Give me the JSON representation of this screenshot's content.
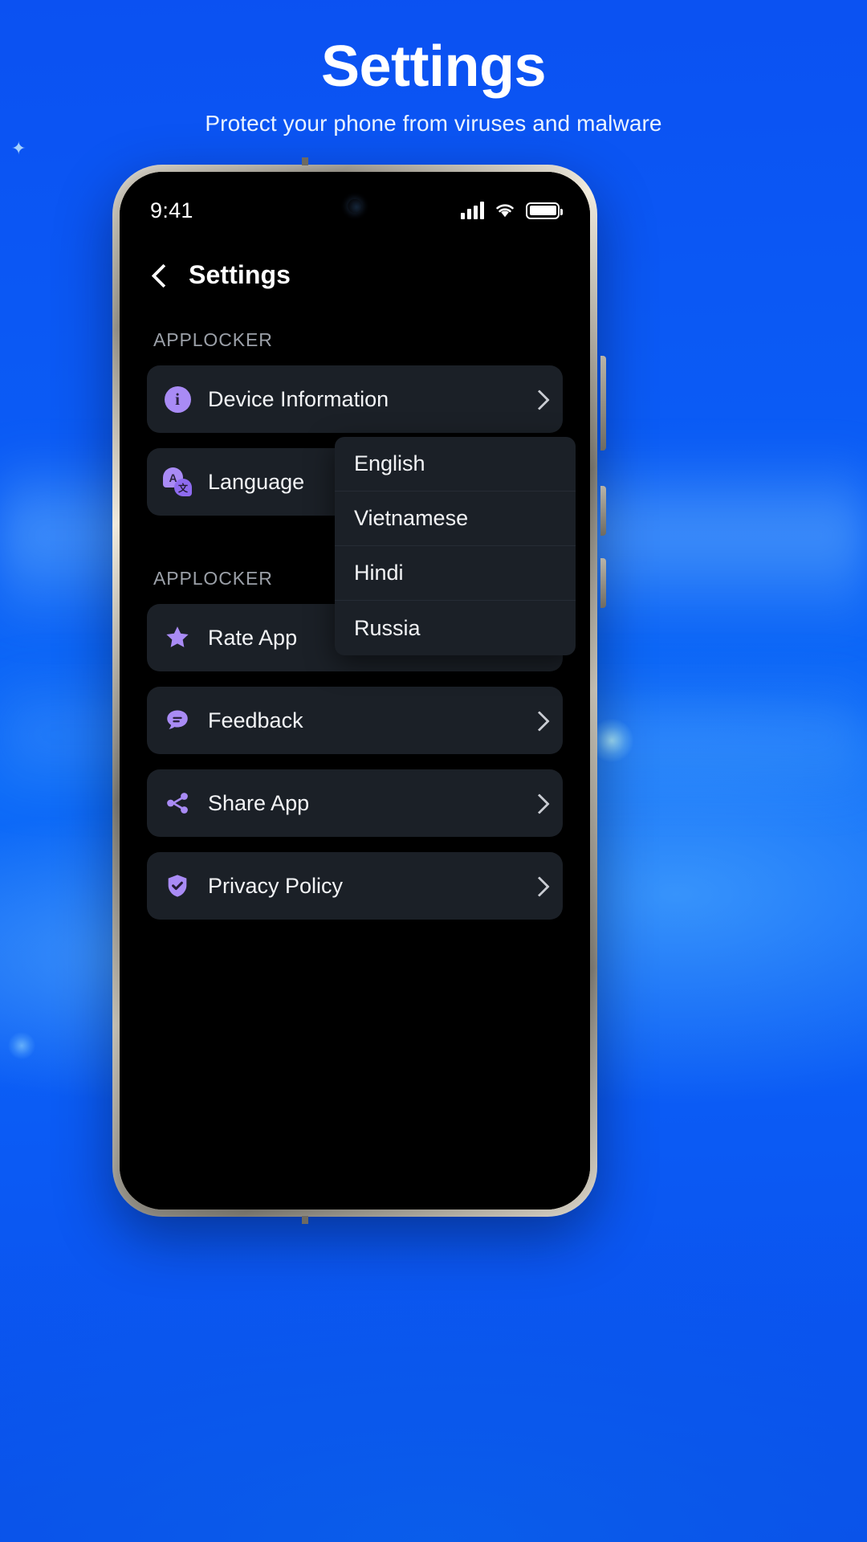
{
  "promo": {
    "title": "Settings",
    "subtitle": "Protect your phone from viruses and malware"
  },
  "phone": {
    "status": {
      "time": "9:41",
      "signal_icon": "signal-bars-icon",
      "wifi_icon": "wifi-icon",
      "battery_icon": "battery-full-icon"
    },
    "nav": {
      "back_icon": "back-chevron-icon",
      "title": "Settings"
    },
    "sections": [
      {
        "header": "APPLOCKER",
        "rows": [
          {
            "label": "Device Information",
            "icon": "info-circle-icon",
            "accessory": "chevron-right-icon",
            "value": ""
          },
          {
            "label": "Language",
            "icon": "language-translate-icon",
            "accessory": "value",
            "value": "English"
          }
        ]
      },
      {
        "header": "APPLOCKER",
        "rows": [
          {
            "label": "Rate App",
            "icon": "star-icon",
            "accessory": "chevron-right-icon",
            "value": ""
          },
          {
            "label": "Feedback",
            "icon": "chat-bubble-icon",
            "accessory": "chevron-right-icon",
            "value": ""
          },
          {
            "label": "Share App",
            "icon": "share-nodes-icon",
            "accessory": "chevron-right-icon",
            "value": ""
          },
          {
            "label": "Privacy Policy",
            "icon": "shield-check-icon",
            "accessory": "chevron-right-icon",
            "value": ""
          }
        ]
      }
    ],
    "language_dropdown": {
      "open": true,
      "options": [
        "English",
        "Vietnamese",
        "Hindi",
        "Russia"
      ],
      "selected": "English"
    }
  },
  "colors": {
    "background_blue": "#0B5BF5",
    "accent_purple": "#A98BF5",
    "card": "#1B2027",
    "section_header": "#9BA0A8"
  }
}
